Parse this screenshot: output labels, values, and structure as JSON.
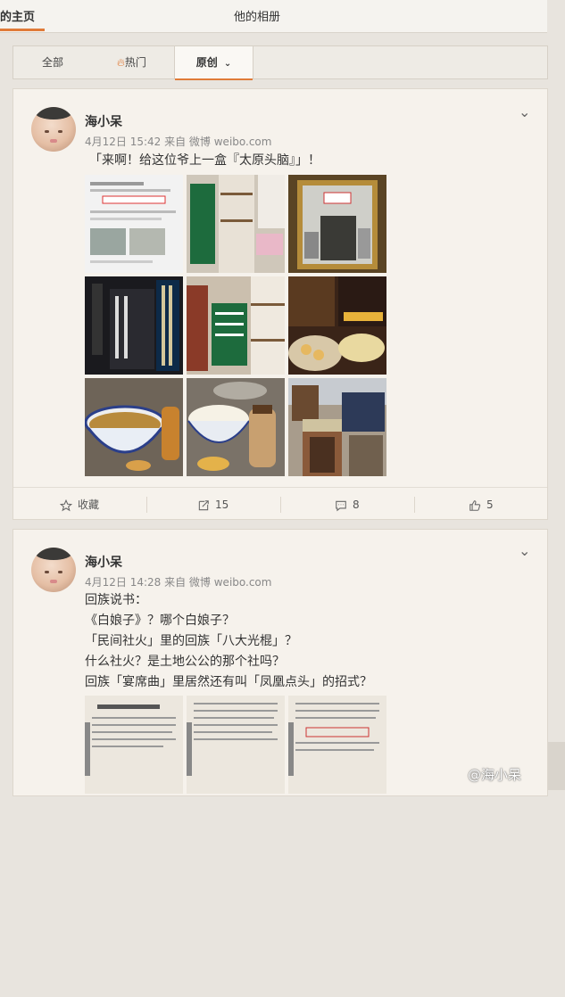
{
  "tabs": [
    {
      "label": "的主页",
      "active": true
    },
    {
      "label": "他的相册",
      "active": false
    }
  ],
  "filters": [
    {
      "label": "全部",
      "icon": ""
    },
    {
      "label": "热门",
      "icon": "fire-icon"
    },
    {
      "label": "原创",
      "icon": "chevron-down-icon",
      "selected": true
    }
  ],
  "posts": [
    {
      "username": "海小呆",
      "meta": "4月12日 15:42 来自 微博 weibo.com",
      "lines": [
        "「来啊！给这位爷上一盒『太原头脑』」！"
      ],
      "actions": {
        "favorite": "收藏",
        "repost": "15",
        "comment": "8",
        "like": "5"
      }
    },
    {
      "username": "海小呆",
      "meta": "4月12日 14:28 来自 微博 weibo.com",
      "lines": [
        "回族说书：",
        "《白娘子》？哪个白娘子？",
        "「民间社火」里的回族「八大光棍」？",
        "什么社火？是土地公公的那个社吗？",
        "回族「宴席曲」里居然还有叫「凤凰点头」的招式？"
      ]
    }
  ],
  "watermark": "@海小呆",
  "colors": {
    "accent": "#e07b39",
    "background": "#e8e4de",
    "card": "#f6f2ec"
  }
}
